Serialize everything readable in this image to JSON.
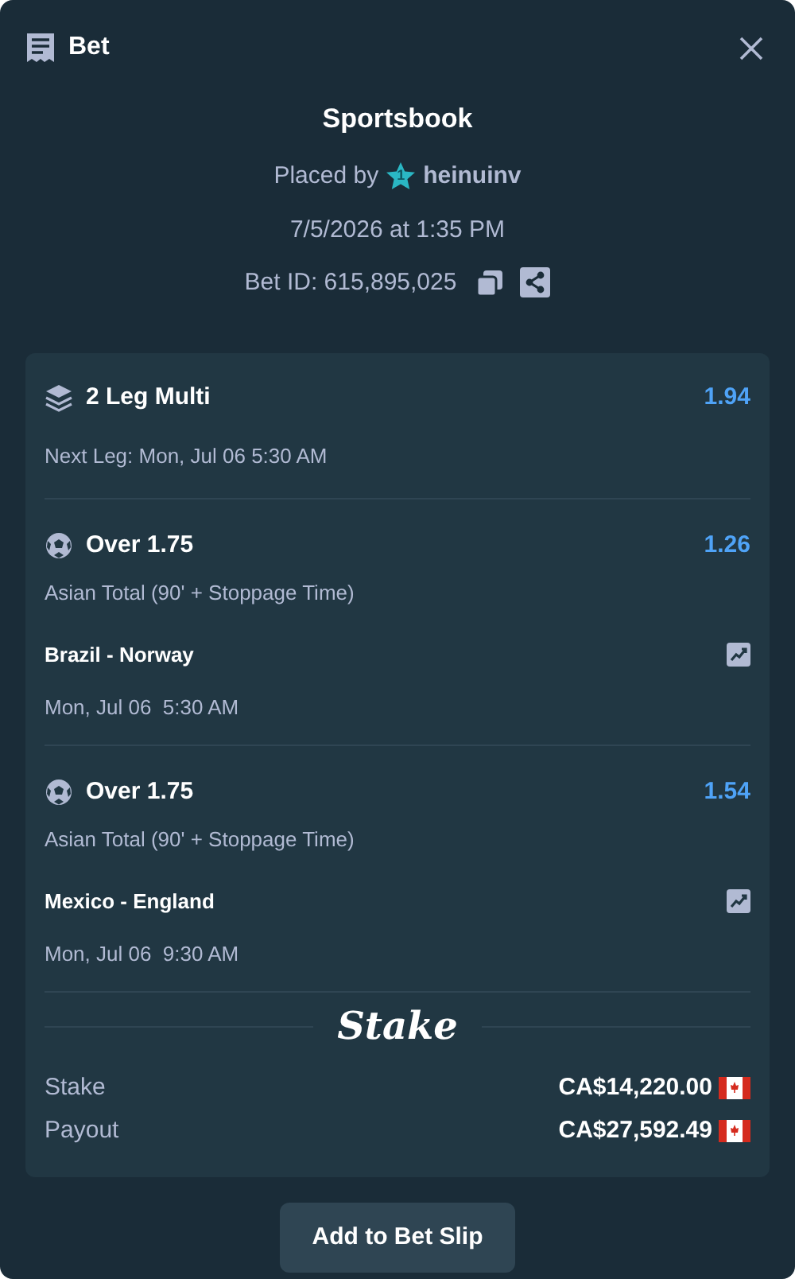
{
  "header": {
    "title": "Bet"
  },
  "summary": {
    "title": "Sportsbook",
    "placed_by_label": "Placed by",
    "rank_badge": "1",
    "username": "heinuinv",
    "placed_at": "7/5/2026 at 1:35 PM",
    "bet_id": "Bet ID: 615,895,025"
  },
  "multi": {
    "title": "2 Leg Multi",
    "odds": "1.94",
    "next_leg": "Next Leg: Mon, Jul 06 5:30 AM"
  },
  "legs": [
    {
      "selection": "Over 1.75",
      "odds": "1.26",
      "market": "Asian Total (90' + Stoppage Time)",
      "match": "Brazil - Norway",
      "time": "Mon, Jul 06  5:30 AM"
    },
    {
      "selection": "Over 1.75",
      "odds": "1.54",
      "market": "Asian Total (90' + Stoppage Time)",
      "match": "Mexico - England",
      "time": "Mon, Jul 06  9:30 AM"
    }
  ],
  "brand": "Stake",
  "totals": [
    {
      "label": "Stake",
      "amount": "CA$14,220.00"
    },
    {
      "label": "Payout",
      "amount": "CA$27,592.49"
    }
  ],
  "button": "Add to Bet Slip"
}
